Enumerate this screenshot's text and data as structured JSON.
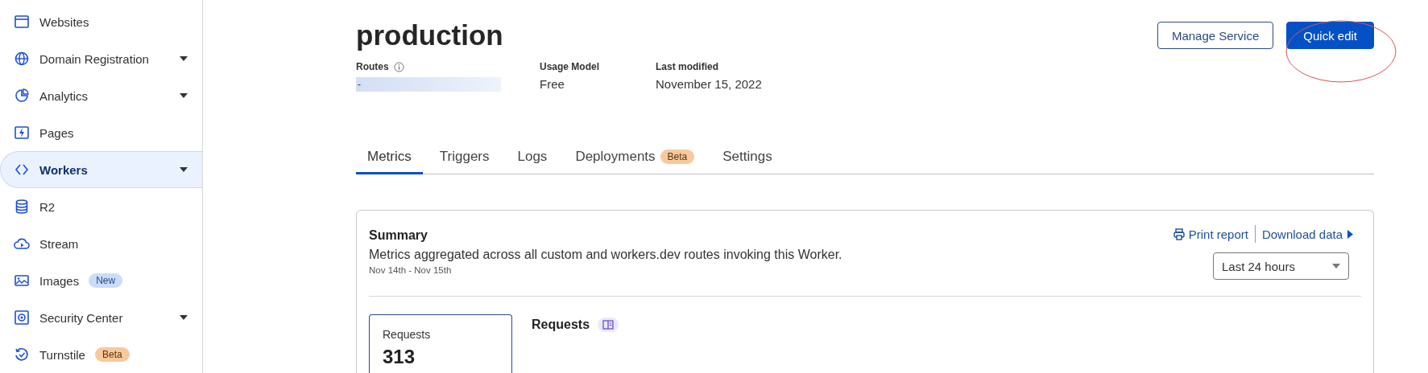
{
  "sidebar": {
    "items": [
      {
        "label": "Websites",
        "selected": false,
        "expandable": false
      },
      {
        "label": "Domain Registration",
        "selected": false,
        "expandable": true
      },
      {
        "label": "Analytics",
        "selected": false,
        "expandable": true
      },
      {
        "label": "Pages",
        "selected": false,
        "expandable": false
      },
      {
        "label": "Workers",
        "selected": true,
        "expandable": true
      },
      {
        "label": "R2",
        "selected": false,
        "expandable": false
      },
      {
        "label": "Stream",
        "selected": false,
        "expandable": false
      },
      {
        "label": "Images",
        "selected": false,
        "expandable": false,
        "badge": {
          "text": "New",
          "color": "#c9dcfa"
        }
      },
      {
        "label": "Security Center",
        "selected": false,
        "expandable": true
      },
      {
        "label": "Turnstile",
        "selected": false,
        "expandable": false,
        "badge": {
          "text": "Beta",
          "color": "#f8c99c"
        }
      }
    ]
  },
  "header": {
    "title": "production",
    "meta": [
      {
        "label": "Routes",
        "value": "-",
        "info": true,
        "redacted": true
      },
      {
        "label": "Usage Model",
        "value": "Free",
        "redacted": false
      },
      {
        "label": "Last modified",
        "value": "November 15, 2022",
        "redacted": false
      }
    ],
    "buttons": [
      {
        "label": "Manage Service",
        "kind": "secondary"
      },
      {
        "label": "Quick edit",
        "kind": "primary"
      }
    ]
  },
  "tabs": [
    {
      "label": "Metrics",
      "selected": true
    },
    {
      "label": "Triggers",
      "selected": false
    },
    {
      "label": "Logs",
      "selected": false
    },
    {
      "label": "Deployments",
      "selected": false,
      "badge": {
        "text": "Beta",
        "color": "#f8c99c"
      }
    },
    {
      "label": "Settings",
      "selected": false
    }
  ],
  "summary": {
    "title": "Summary",
    "description": "Metrics aggregated across all custom and workers.dev routes invoking this Worker.",
    "date_range": "Nov 14th - Nov 15th",
    "actions": [
      {
        "label": "Print report",
        "kind": "print"
      },
      {
        "label": "Download data",
        "kind": "download"
      }
    ],
    "time_range": {
      "value": "Last 24 hours"
    },
    "stat": {
      "label": "Requests",
      "value": "313"
    },
    "section_title": "Requests"
  }
}
